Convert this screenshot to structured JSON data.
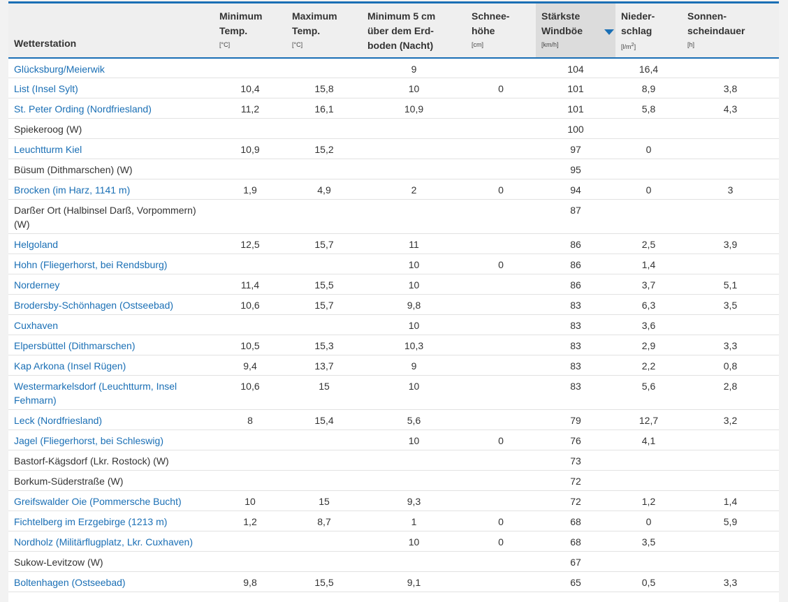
{
  "headers": {
    "station": {
      "label": "Wetterstation"
    },
    "min_temp": {
      "line1": "Minimum",
      "line2": "Temp.",
      "unit": "[°C]"
    },
    "max_temp": {
      "line1": "Maximum",
      "line2": "Temp.",
      "unit": "[°C]"
    },
    "min_5cm": {
      "line1": "Minimum 5 cm",
      "line2": "über dem Erd-",
      "line3": "boden (Nacht)"
    },
    "snow": {
      "line1": "Schnee-",
      "line2": "höhe",
      "unit": "[cm]"
    },
    "gust": {
      "line1": "Stärkste",
      "line2": "Windböe",
      "unit": "[km/h]"
    },
    "precip": {
      "line1": "Nieder-",
      "line2": "schlag",
      "unit": "[l/m",
      "unit_sup": "2",
      "unit_end": "]"
    },
    "sun": {
      "line1": "Sonnen-",
      "line2": "scheindauer",
      "unit": "[h]"
    }
  },
  "rows": [
    {
      "station": "Glücksburg/Meierwik",
      "link": true,
      "min": "",
      "max": "",
      "min5": "9",
      "snow": "",
      "gust": "104",
      "precip": "16,4",
      "sun": ""
    },
    {
      "station": "List (Insel Sylt)",
      "link": true,
      "min": "10,4",
      "max": "15,8",
      "min5": "10",
      "snow": "0",
      "gust": "101",
      "precip": "8,9",
      "sun": "3,8"
    },
    {
      "station": "St. Peter Ording (Nordfriesland)",
      "link": true,
      "min": "11,2",
      "max": "16,1",
      "min5": "10,9",
      "snow": "",
      "gust": "101",
      "precip": "5,8",
      "sun": "4,3"
    },
    {
      "station": "Spiekeroog (W)",
      "link": false,
      "min": "",
      "max": "",
      "min5": "",
      "snow": "",
      "gust": "100",
      "precip": "",
      "sun": ""
    },
    {
      "station": "Leuchtturm Kiel",
      "link": true,
      "min": "10,9",
      "max": "15,2",
      "min5": "",
      "snow": "",
      "gust": "97",
      "precip": "0",
      "sun": ""
    },
    {
      "station": "Büsum (Dithmarschen) (W)",
      "link": false,
      "min": "",
      "max": "",
      "min5": "",
      "snow": "",
      "gust": "95",
      "precip": "",
      "sun": ""
    },
    {
      "station": "Brocken (im Harz, 1141 m)",
      "link": true,
      "min": "1,9",
      "max": "4,9",
      "min5": "2",
      "snow": "0",
      "gust": "94",
      "precip": "0",
      "sun": "3"
    },
    {
      "station": "Darßer Ort (Halbinsel Darß, Vorpommern) (W)",
      "link": false,
      "min": "",
      "max": "",
      "min5": "",
      "snow": "",
      "gust": "87",
      "precip": "",
      "sun": ""
    },
    {
      "station": "Helgoland",
      "link": true,
      "min": "12,5",
      "max": "15,7",
      "min5": "11",
      "snow": "",
      "gust": "86",
      "precip": "2,5",
      "sun": "3,9"
    },
    {
      "station": "Hohn (Fliegerhorst, bei Rendsburg)",
      "link": true,
      "min": "",
      "max": "",
      "min5": "10",
      "snow": "0",
      "gust": "86",
      "precip": "1,4",
      "sun": ""
    },
    {
      "station": "Norderney",
      "link": true,
      "min": "11,4",
      "max": "15,5",
      "min5": "10",
      "snow": "",
      "gust": "86",
      "precip": "3,7",
      "sun": "5,1"
    },
    {
      "station": "Brodersby-Schönhagen (Ostseebad)",
      "link": true,
      "min": "10,6",
      "max": "15,7",
      "min5": "9,8",
      "snow": "",
      "gust": "83",
      "precip": "6,3",
      "sun": "3,5"
    },
    {
      "station": "Cuxhaven",
      "link": true,
      "min": "",
      "max": "",
      "min5": "10",
      "snow": "",
      "gust": "83",
      "precip": "3,6",
      "sun": ""
    },
    {
      "station": "Elpersbüttel (Dithmarschen)",
      "link": true,
      "min": "10,5",
      "max": "15,3",
      "min5": "10,3",
      "snow": "",
      "gust": "83",
      "precip": "2,9",
      "sun": "3,3"
    },
    {
      "station": "Kap Arkona (Insel Rügen)",
      "link": true,
      "min": "9,4",
      "max": "13,7",
      "min5": "9",
      "snow": "",
      "gust": "83",
      "precip": "2,2",
      "sun": "0,8"
    },
    {
      "station": "Westermarkelsdorf (Leuchtturm, Insel Fehmarn)",
      "link": true,
      "min": "10,6",
      "max": "15",
      "min5": "10",
      "snow": "",
      "gust": "83",
      "precip": "5,6",
      "sun": "2,8"
    },
    {
      "station": "Leck (Nordfriesland)",
      "link": true,
      "min": "8",
      "max": "15,4",
      "min5": "5,6",
      "snow": "",
      "gust": "79",
      "precip": "12,7",
      "sun": "3,2"
    },
    {
      "station": "Jagel (Fliegerhorst, bei Schleswig)",
      "link": true,
      "min": "",
      "max": "",
      "min5": "10",
      "snow": "0",
      "gust": "76",
      "precip": "4,1",
      "sun": ""
    },
    {
      "station": "Bastorf-Kägsdorf (Lkr. Rostock) (W)",
      "link": false,
      "min": "",
      "max": "",
      "min5": "",
      "snow": "",
      "gust": "73",
      "precip": "",
      "sun": ""
    },
    {
      "station": "Borkum-Süderstraße (W)",
      "link": false,
      "min": "",
      "max": "",
      "min5": "",
      "snow": "",
      "gust": "72",
      "precip": "",
      "sun": ""
    },
    {
      "station": "Greifswalder Oie (Pommersche Bucht)",
      "link": true,
      "min": "10",
      "max": "15",
      "min5": "9,3",
      "snow": "",
      "gust": "72",
      "precip": "1,2",
      "sun": "1,4"
    },
    {
      "station": "Fichtelberg im Erzgebirge (1213 m)",
      "link": true,
      "min": "1,2",
      "max": "8,7",
      "min5": "1",
      "snow": "0",
      "gust": "68",
      "precip": "0",
      "sun": "5,9"
    },
    {
      "station": "Nordholz (Militärflugplatz, Lkr. Cuxhaven)",
      "link": true,
      "min": "",
      "max": "",
      "min5": "10",
      "snow": "0",
      "gust": "68",
      "precip": "3,5",
      "sun": ""
    },
    {
      "station": "Sukow-Levitzow (W)",
      "link": false,
      "min": "",
      "max": "",
      "min5": "",
      "snow": "",
      "gust": "67",
      "precip": "",
      "sun": ""
    },
    {
      "station": "Boltenhagen (Ostseebad)",
      "link": true,
      "min": "9,8",
      "max": "15,5",
      "min5": "9,1",
      "snow": "",
      "gust": "65",
      "precip": "0,5",
      "sun": "3,3"
    }
  ],
  "colors": {
    "link": "#1a6fb5",
    "accent": "#1a6fb5",
    "sorted_header_bg": "#dcdcdc"
  },
  "icons": {
    "sort": "sort-descending-icon"
  }
}
